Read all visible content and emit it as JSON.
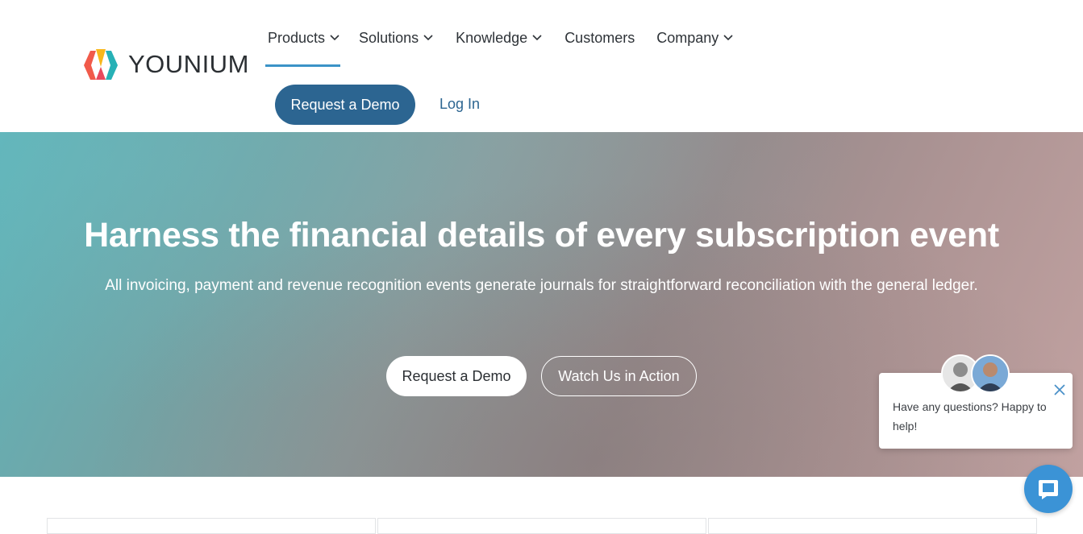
{
  "brand": {
    "name": "YOUNIUM",
    "colors": {
      "red": "#f15a4a",
      "yellow": "#f8b71b",
      "teal": "#27b1b6"
    }
  },
  "nav": {
    "items": [
      {
        "label": "Products",
        "has_dropdown": true,
        "active": true
      },
      {
        "label": "Solutions",
        "has_dropdown": true,
        "active": false
      },
      {
        "label": "Knowledge",
        "has_dropdown": true,
        "active": false
      },
      {
        "label": "Customers",
        "has_dropdown": false,
        "active": false
      },
      {
        "label": "Company",
        "has_dropdown": true,
        "active": false
      }
    ],
    "request_demo_label": "Request a Demo",
    "login_label": "Log In",
    "accent_color": "#2c6591",
    "active_underline_color": "#3b93c7"
  },
  "hero": {
    "title": "Harness the financial details of every subscription event",
    "subtitle": "All invoicing, payment and revenue recognition events generate journals for straightforward reconciliation with the general ledger.",
    "primary_button": "Request a Demo",
    "secondary_button": "Watch Us in Action"
  },
  "chat": {
    "message": "Have any questions? Happy to help!",
    "button_color": "#3b93d6"
  }
}
